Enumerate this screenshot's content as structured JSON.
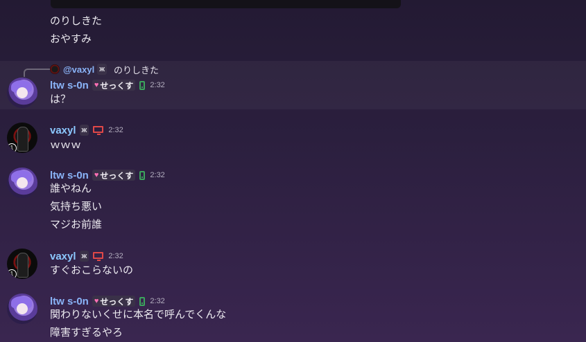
{
  "top_messages": [
    "のりしきた",
    "おやすみ"
  ],
  "reply": {
    "username": "@vaxyl",
    "tag_icon": "butterfly-icon",
    "text": "のりしきた"
  },
  "groups": [
    {
      "user": "ltw s-0n",
      "tag": "せっくす",
      "tag_icon": "heart-icon",
      "device": "phone-icon",
      "time": "2:32",
      "lines": [
        "は？"
      ]
    },
    {
      "user": "vaxyl",
      "tag": "",
      "tag_icon": "butterfly-icon",
      "device": "monitor-icon",
      "time": "2:32",
      "lines": [
        "ｗｗｗ"
      ]
    },
    {
      "user": "ltw s-0n",
      "tag": "せっくす",
      "tag_icon": "heart-icon",
      "device": "phone-icon",
      "time": "2:32",
      "lines": [
        "誰やねん",
        "気持ち悪い",
        "マジお前誰"
      ]
    },
    {
      "user": "vaxyl",
      "tag": "",
      "tag_icon": "butterfly-icon",
      "device": "monitor-icon",
      "time": "2:32",
      "lines": [
        "すぐおこらないの"
      ]
    },
    {
      "user": "ltw s-0n",
      "tag": "せっくす",
      "tag_icon": "heart-icon",
      "device": "phone-icon",
      "time": "2:32",
      "lines": [
        "関わりないくせに本名で呼んでくんな",
        "障害すぎるやろ"
      ]
    }
  ],
  "colors": {
    "username_ltw": "#8ab4f8",
    "username_vaxyl": "#8cc8ff",
    "phone": "#3ba55d",
    "monitor": "#e04848",
    "heart": "#ff6fb5"
  }
}
